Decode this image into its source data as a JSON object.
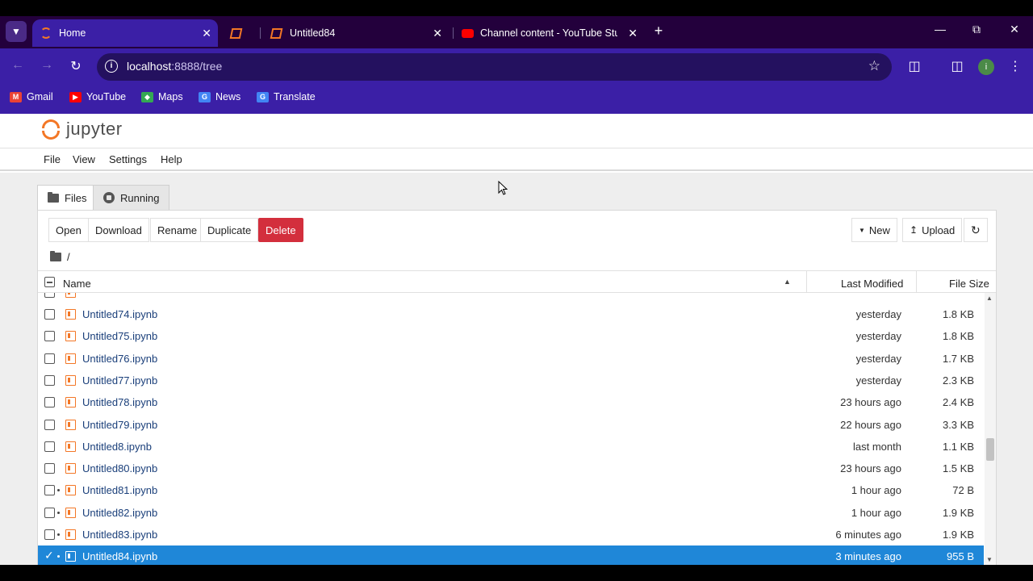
{
  "browser": {
    "tabs": [
      {
        "title": "Home",
        "active": true
      },
      {
        "title": "",
        "active": false
      },
      {
        "title": "Untitled84",
        "active": false
      },
      {
        "title": "Channel content - YouTube Stu",
        "active": false
      }
    ],
    "url_host": "localhost",
    "url_path": ":8888/tree",
    "bookmarks": [
      {
        "label": "Gmail",
        "icon": "gmail-icon",
        "color": "#ea4335"
      },
      {
        "label": "YouTube",
        "icon": "youtube-icon",
        "color": "#ff0000"
      },
      {
        "label": "Maps",
        "icon": "maps-icon",
        "color": "#34a853"
      },
      {
        "label": "News",
        "icon": "news-icon",
        "color": "#4285f4"
      },
      {
        "label": "Translate",
        "icon": "translate-icon",
        "color": "#4285f4"
      }
    ],
    "profile_initial": "i"
  },
  "jupyter": {
    "logo_text": "jupyter",
    "menu": [
      "File",
      "View",
      "Settings",
      "Help"
    ],
    "tabs": [
      {
        "label": "Files",
        "active": true
      },
      {
        "label": "Running",
        "active": false
      }
    ],
    "actions": {
      "open": "Open",
      "download": "Download",
      "rename": "Rename",
      "duplicate": "Duplicate",
      "delete": "Delete",
      "new": "New",
      "upload": "Upload"
    },
    "breadcrumb": "/",
    "columns": {
      "name": "Name",
      "modified": "Last Modified",
      "size": "File Size"
    },
    "files": [
      {
        "name": "Untitled74.ipynb",
        "modified": "yesterday",
        "size": "1.8 KB",
        "running": false,
        "selected": false
      },
      {
        "name": "Untitled75.ipynb",
        "modified": "yesterday",
        "size": "1.8 KB",
        "running": false,
        "selected": false
      },
      {
        "name": "Untitled76.ipynb",
        "modified": "yesterday",
        "size": "1.7 KB",
        "running": false,
        "selected": false
      },
      {
        "name": "Untitled77.ipynb",
        "modified": "yesterday",
        "size": "2.3 KB",
        "running": false,
        "selected": false
      },
      {
        "name": "Untitled78.ipynb",
        "modified": "23 hours ago",
        "size": "2.4 KB",
        "running": false,
        "selected": false
      },
      {
        "name": "Untitled79.ipynb",
        "modified": "22 hours ago",
        "size": "3.3 KB",
        "running": false,
        "selected": false
      },
      {
        "name": "Untitled8.ipynb",
        "modified": "last month",
        "size": "1.1 KB",
        "running": false,
        "selected": false
      },
      {
        "name": "Untitled80.ipynb",
        "modified": "23 hours ago",
        "size": "1.5 KB",
        "running": false,
        "selected": false
      },
      {
        "name": "Untitled81.ipynb",
        "modified": "1 hour ago",
        "size": "72 B",
        "running": true,
        "selected": false
      },
      {
        "name": "Untitled82.ipynb",
        "modified": "1 hour ago",
        "size": "1.9 KB",
        "running": true,
        "selected": false
      },
      {
        "name": "Untitled83.ipynb",
        "modified": "6 minutes ago",
        "size": "1.9 KB",
        "running": true,
        "selected": false
      },
      {
        "name": "Untitled84.ipynb",
        "modified": "3 minutes ago",
        "size": "955 B",
        "running": true,
        "selected": true
      }
    ],
    "colors": {
      "accent": "#f37726",
      "selected": "#1f87d8",
      "danger": "#d32f3d"
    }
  }
}
